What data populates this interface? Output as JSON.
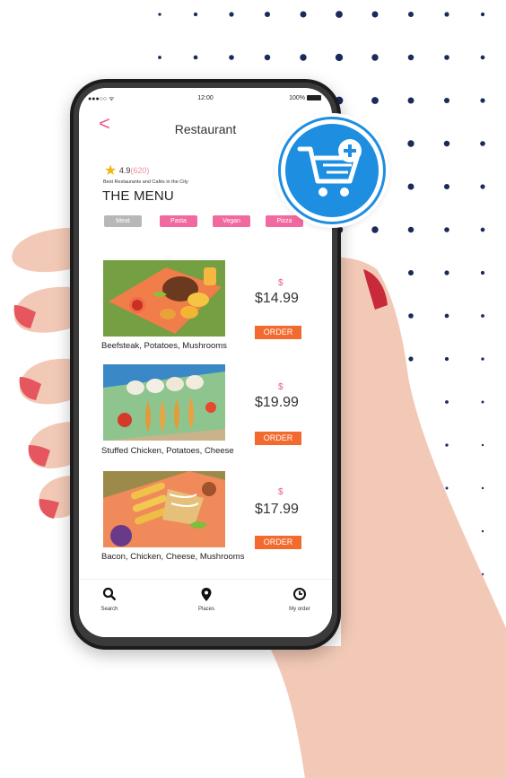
{
  "status_bar": {
    "signal": "●●●○○ ᯤ",
    "time": "12:00",
    "battery": "100%"
  },
  "header": {
    "back_glyph": "<",
    "title": "Restaurant"
  },
  "restaurant": {
    "rating": "4.9",
    "rating_count": "(620)",
    "tagline": "Best Restaurants and Cafés in the City",
    "menu_heading": "THE MENU"
  },
  "categories": [
    {
      "label": "Meat",
      "selected": true
    },
    {
      "label": "Pasta",
      "selected": false
    },
    {
      "label": "Vegan",
      "selected": false
    },
    {
      "label": "Pizza",
      "selected": false
    }
  ],
  "menu_items": [
    {
      "currency": "$",
      "price": "$14.99",
      "order_label": "ORDER",
      "name": "Beefsteak, Potatoes, Mushrooms"
    },
    {
      "currency": "$",
      "price": "$19.99",
      "order_label": "ORDER",
      "name": "Stuffed Chicken, Potatoes, Cheese"
    },
    {
      "currency": "$",
      "price": "$17.99",
      "order_label": "ORDER",
      "name": "Bacon, Chicken, Cheese, Mushrooms"
    }
  ],
  "tab_bar": [
    {
      "label": "Search",
      "icon": "search-icon"
    },
    {
      "label": "Places",
      "icon": "map-pin-icon"
    },
    {
      "label": "My order",
      "icon": "clock-icon"
    }
  ],
  "cart_badge": {
    "icon": "add-to-cart-icon"
  },
  "colors": {
    "accent_pink": "#f06aa0",
    "order_orange": "#f26a2e",
    "cart_blue": "#1d8ee0",
    "dot_navy": "#1a2a5a"
  }
}
